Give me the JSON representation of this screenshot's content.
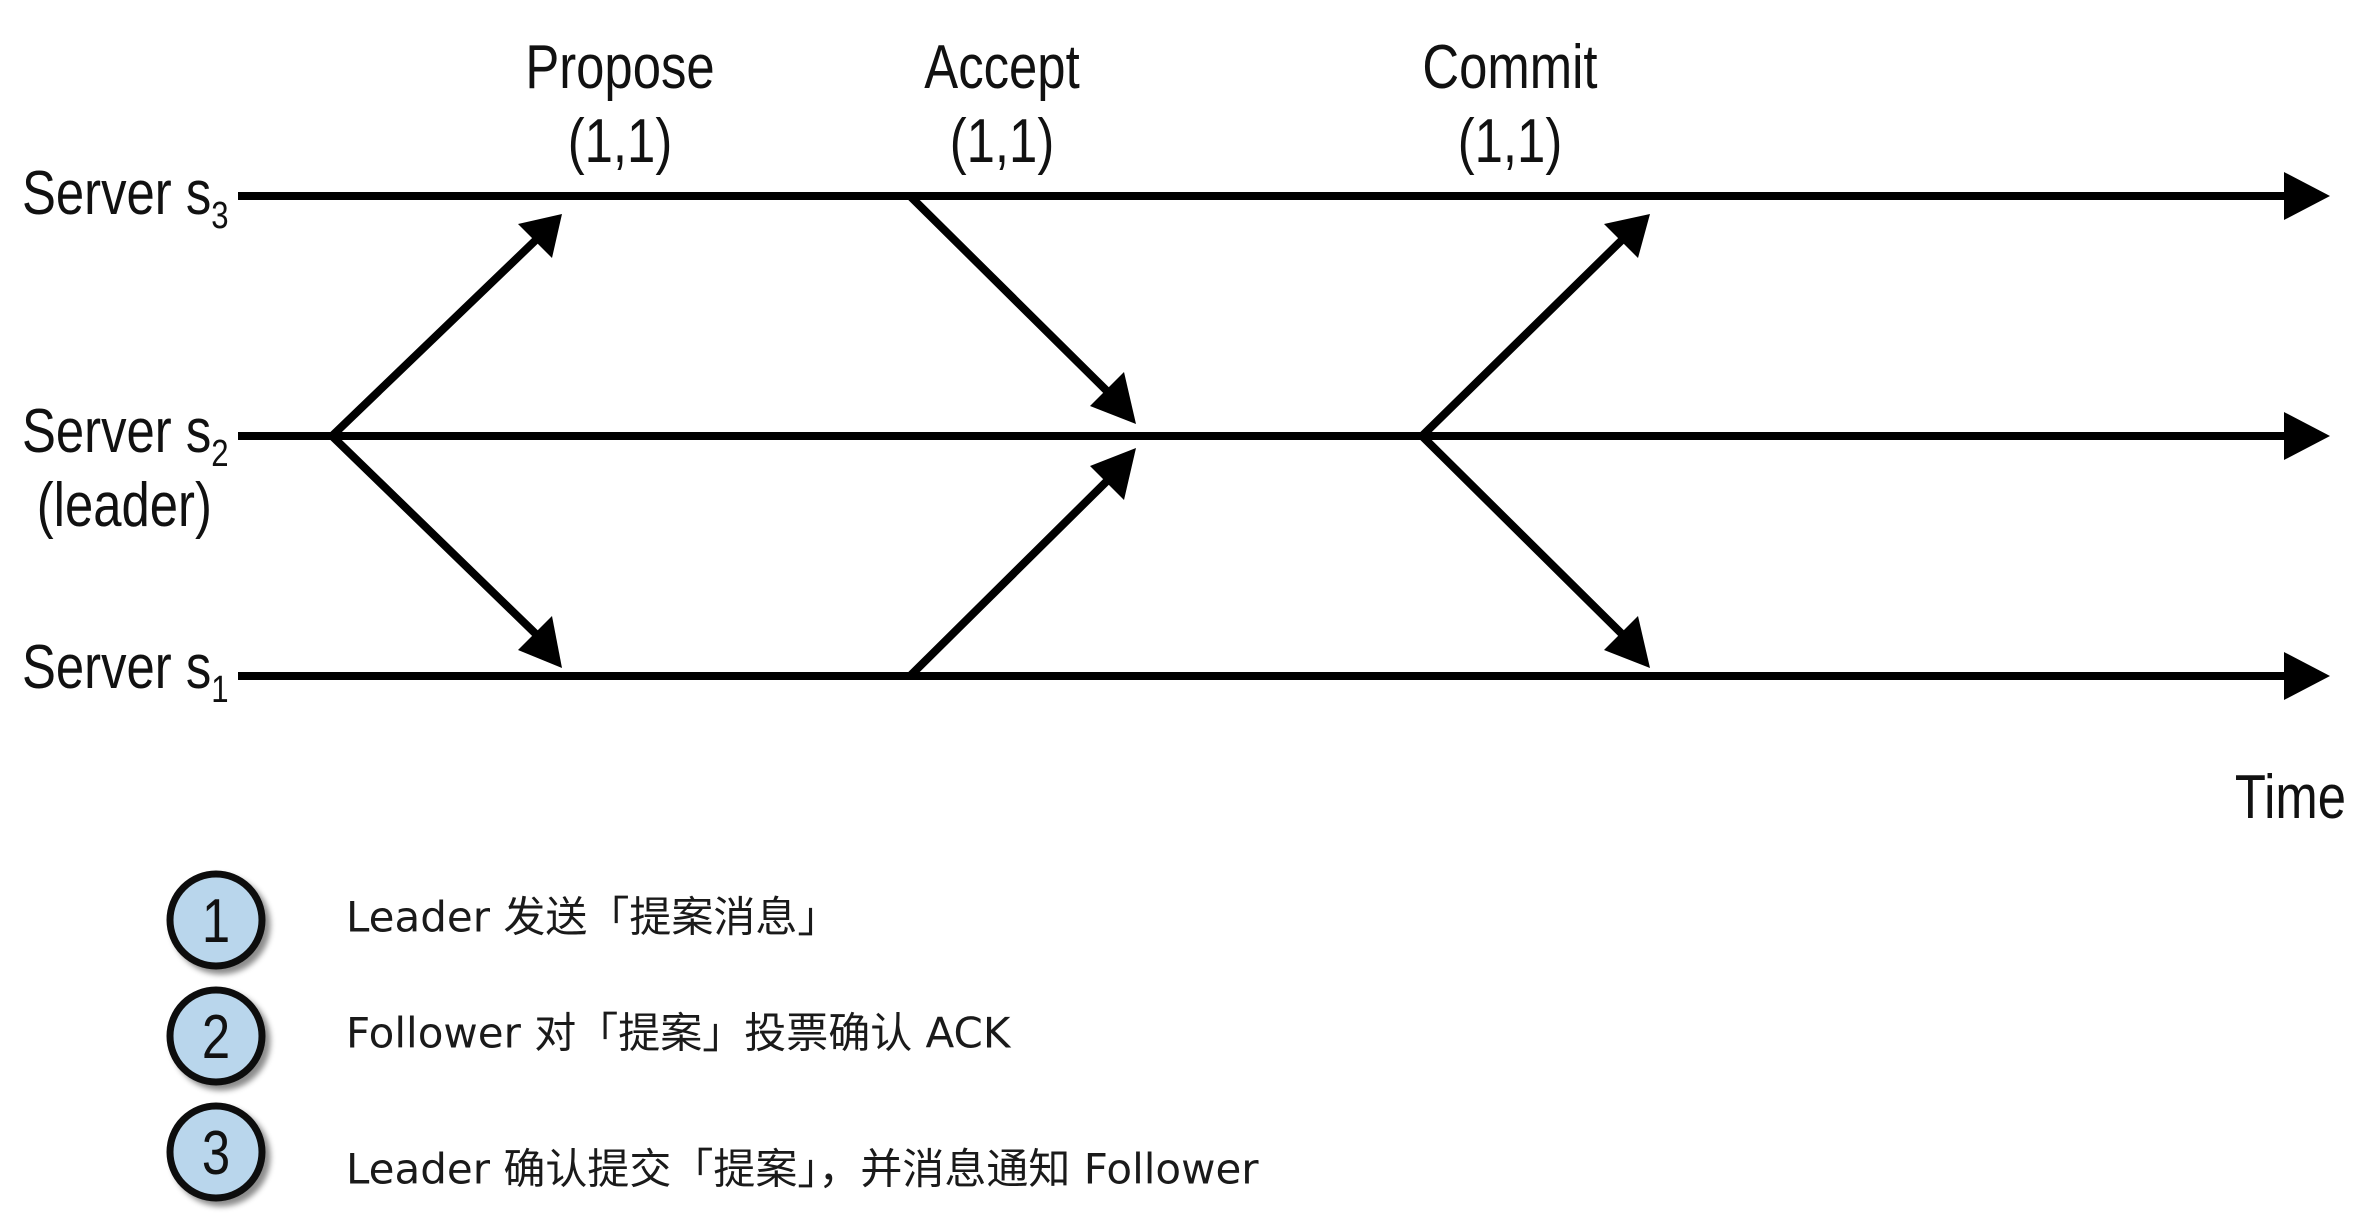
{
  "servers": [
    {
      "id": "s3",
      "label": "Server s",
      "sub": "3",
      "extra": ""
    },
    {
      "id": "s2",
      "label": "Server s",
      "sub": "2",
      "extra": "(leader)"
    },
    {
      "id": "s1",
      "label": "Server s",
      "sub": "1",
      "extra": ""
    }
  ],
  "phases": [
    {
      "name": "Propose",
      "value": "(1,1)"
    },
    {
      "name": "Accept",
      "value": "(1,1)"
    },
    {
      "name": "Commit",
      "value": "(1,1)"
    }
  ],
  "time_label": "Time",
  "steps": [
    {
      "number": "1",
      "text": "Leader 发送「提案消息」"
    },
    {
      "number": "2",
      "text": "Follower 对「提案」投票确认 ACK"
    },
    {
      "number": "3",
      "text": "Leader 确认提交「提案」，并消息通知 Follower"
    }
  ],
  "colors": {
    "line": "#000000",
    "badge_fill": "#b9d6ec",
    "badge_stroke": "#111111",
    "text": "#111111"
  }
}
